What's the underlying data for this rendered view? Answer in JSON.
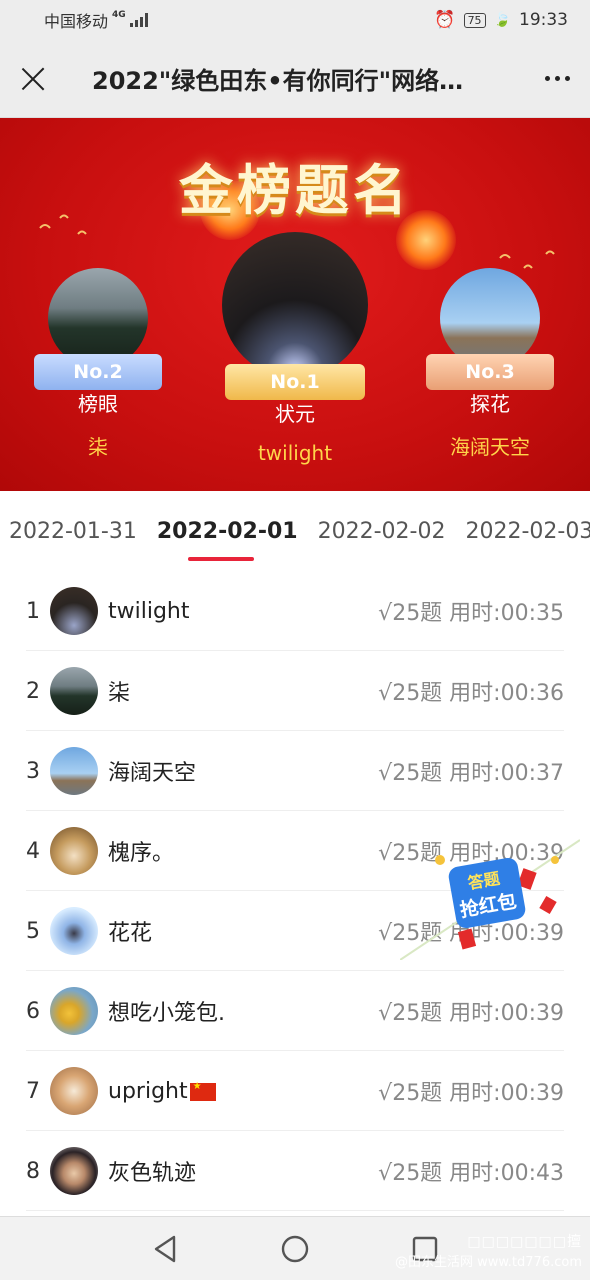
{
  "status": {
    "carrier": "中国移动",
    "network": "4G",
    "battery": "75",
    "time": "19:33"
  },
  "topbar": {
    "title": "2022\"绿色田东•有你同行\"网络…"
  },
  "banner": {
    "heading": "金榜题名",
    "podium": [
      {
        "no": "No.2",
        "title": "榜眼",
        "name": "柒"
      },
      {
        "no": "No.1",
        "title": "状元",
        "name": "twilight"
      },
      {
        "no": "No.3",
        "title": "探花",
        "name": "海阔天空"
      }
    ]
  },
  "tabs": [
    "2022-01-31",
    "2022-02-01",
    "2022-02-02",
    "2022-02-03"
  ],
  "active_tab": "2022-02-01",
  "rows": [
    {
      "rank": "1",
      "name": "twilight",
      "result": "√25题 用时:00:35",
      "avatar": "night-trees"
    },
    {
      "rank": "2",
      "name": "柒",
      "result": "√25题 用时:00:36",
      "avatar": "mountain-lake"
    },
    {
      "rank": "3",
      "name": "海阔天空",
      "result": "√25题 用时:00:37",
      "avatar": "pavilion"
    },
    {
      "rank": "4",
      "name": "槐序。",
      "result": "√25题 用时:00:39",
      "avatar": "cat-bear"
    },
    {
      "rank": "5",
      "name": "花花",
      "result": "√25题 用时:00:39",
      "avatar": "girl-blue"
    },
    {
      "rank": "6",
      "name": "想吃小笼包.",
      "result": "√25题 用时:00:39",
      "avatar": "girl-yellow"
    },
    {
      "rank": "7",
      "name": "upright",
      "result": "√25题 用时:00:39",
      "avatar": "dog"
    },
    {
      "rank": "8",
      "name": "灰色轨迹",
      "result": "√25题 用时:00:43",
      "avatar": "man-portrait"
    }
  ],
  "red_packet": {
    "line1": "答题",
    "line2": "抢红包"
  },
  "watermark": {
    "line1": "□□□□□□□擅",
    "line2": "@田东生活网 www.td776.com"
  },
  "colors": {
    "accent": "#e8243a",
    "banner": "#c80f0f",
    "gold": "#ffd54a"
  }
}
